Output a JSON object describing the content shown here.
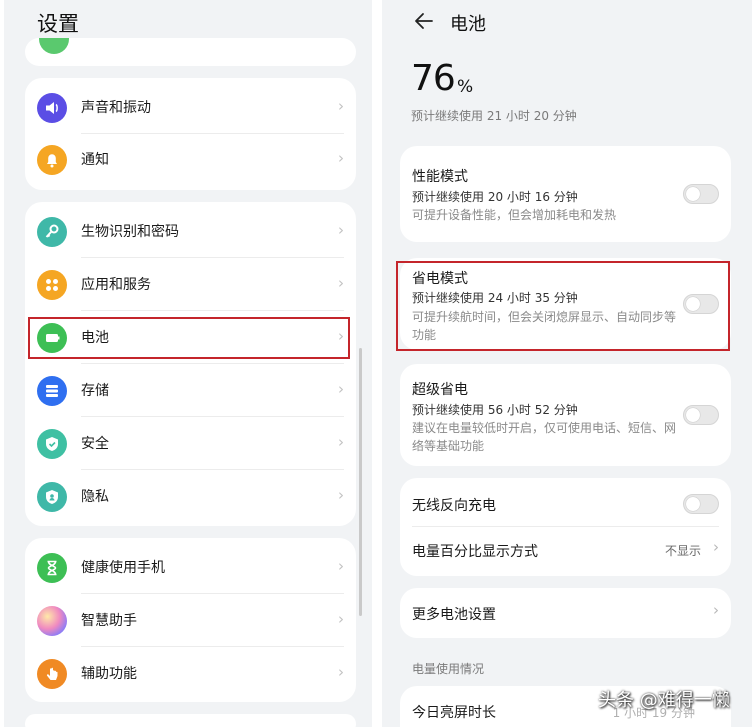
{
  "colors": {
    "accent_red": "#c4252b",
    "sound_icon": "#5b4ee5",
    "notify_icon": "#f5a623",
    "bio_icon": "#3fb8a8",
    "apps_icon": "#f5a623",
    "battery_icon": "#3dbf55",
    "storage_icon": "#2f6ff0",
    "security_icon": "#3fc0a3",
    "privacy_icon": "#3fb8a8",
    "health_icon": "#3dbf55",
    "assistant_icon": "#b07cf0",
    "access_icon": "#f08a24"
  },
  "settings": {
    "title": "设置",
    "groups": [
      {
        "items": [
          {
            "label": "声音和振动",
            "icon": "speaker-icon"
          },
          {
            "label": "通知",
            "icon": "bell-icon"
          }
        ]
      },
      {
        "items": [
          {
            "label": "生物识别和密码",
            "icon": "key-icon"
          },
          {
            "label": "应用和服务",
            "icon": "apps-grid-icon"
          },
          {
            "label": "电池",
            "icon": "battery-icon"
          },
          {
            "label": "存储",
            "icon": "storage-icon"
          },
          {
            "label": "安全",
            "icon": "shield-check-icon"
          },
          {
            "label": "隐私",
            "icon": "privacy-shield-icon"
          }
        ]
      },
      {
        "items": [
          {
            "label": "健康使用手机",
            "icon": "hourglass-icon"
          },
          {
            "label": "智慧助手",
            "icon": "assistant-orb-icon"
          },
          {
            "label": "辅助功能",
            "icon": "hand-icon"
          }
        ]
      }
    ]
  },
  "battery": {
    "title": "电池",
    "percent": "76",
    "percent_symbol": "%",
    "estimate": "预计继续使用 21 小时 20 分钟",
    "performance": {
      "title": "性能模式",
      "estimate": "预计继续使用 20 小时 16 分钟",
      "desc": "可提升设备性能，但会增加耗电和发热"
    },
    "power_saving": {
      "title": "省电模式",
      "estimate": "预计继续使用 24 小时 35 分钟",
      "desc": "可提升续航时间，但会关闭熄屏显示、自动同步等功能"
    },
    "super_saving": {
      "title": "超级省电",
      "estimate": "预计继续使用 56 小时 52 分钟",
      "desc": "建议在电量较低时开启，仅可使用电话、短信、网络等基础功能"
    },
    "wireless_reverse": "无线反向充电",
    "percent_display": {
      "label": "电量百分比显示方式",
      "value": "不显示"
    },
    "more_settings": "更多电池设置",
    "usage_section": "电量使用情况",
    "screen_time": {
      "label": "今日亮屏时长",
      "value": "1 小时 19 分钟"
    }
  },
  "watermark": "头条 @难得一懒"
}
